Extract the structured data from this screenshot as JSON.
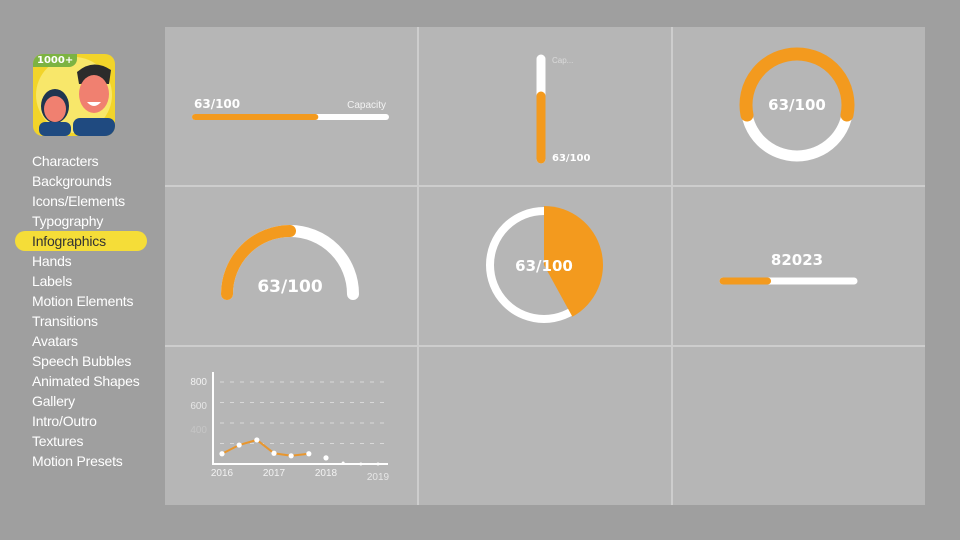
{
  "logo": {
    "badge": "1000+"
  },
  "sidebar": {
    "items": [
      {
        "label": "Characters"
      },
      {
        "label": "Backgrounds"
      },
      {
        "label": "Icons/Elements"
      },
      {
        "label": "Typography"
      },
      {
        "label": "Infographics",
        "active": true
      },
      {
        "label": "Hands"
      },
      {
        "label": "Labels"
      },
      {
        "label": "Motion Elements"
      },
      {
        "label": "Transitions"
      },
      {
        "label": "Avatars"
      },
      {
        "label": "Speech Bubbles"
      },
      {
        "label": "Animated Shapes"
      },
      {
        "label": "Gallery"
      },
      {
        "label": "Intro/Outro"
      },
      {
        "label": "Textures"
      },
      {
        "label": "Motion Presets"
      }
    ]
  },
  "colors": {
    "accent": "#f39a1e",
    "highlight": "#f5dd38",
    "track": "#ffffff"
  },
  "widgets": {
    "hbar": {
      "value": "63/100",
      "label": "Capacity",
      "progress": 0.63
    },
    "vbar": {
      "value": "63/100",
      "label": "Cap...",
      "progress": 0.63
    },
    "ring": {
      "value": "63/100"
    },
    "gauge": {
      "value": "63/100",
      "progress": 0.5
    },
    "pie": {
      "value": "63/100",
      "progress": 0.42
    },
    "counter": {
      "value": "82023",
      "progress": 0.34
    }
  },
  "chart_data": {
    "type": "line",
    "y_ticks": [
      "800",
      "600",
      "400"
    ],
    "x_ticks": [
      "2016",
      "2017",
      "2018",
      "2019"
    ],
    "ylim": [
      0,
      800
    ],
    "x": [
      2016,
      2016.33,
      2016.67,
      2017,
      2017.33,
      2017.67,
      2018,
      2018.33,
      2018.67,
      2019
    ],
    "y": [
      100,
      185,
      235,
      105,
      80,
      100,
      60,
      10,
      0,
      0
    ],
    "grid": true
  }
}
